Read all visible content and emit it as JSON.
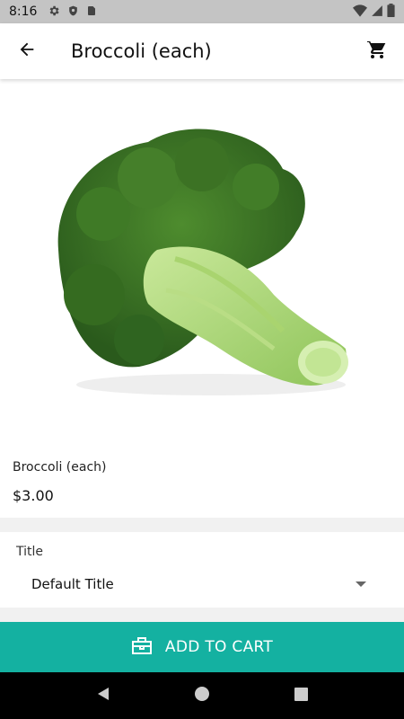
{
  "status_bar": {
    "time": "8:16",
    "icons": [
      "gear-icon",
      "shield-icon",
      "sim-card-icon",
      "wifi-icon",
      "signal-icon",
      "battery-icon"
    ]
  },
  "app_bar": {
    "title": "Broccoli (each)",
    "back_icon": "arrow-back-icon",
    "cart_icon": "shopping-cart-icon"
  },
  "product": {
    "image": "broccoli-image",
    "name": "Broccoli (each)",
    "price": "$3.00"
  },
  "variant": {
    "label": "Title",
    "selected": "Default Title"
  },
  "add_to_cart": {
    "label": "ADD TO CART",
    "icon": "briefcase-icon",
    "color": "#14b1a1"
  },
  "nav_bar": {
    "icons": [
      "back-triangle-icon",
      "home-circle-icon",
      "recents-square-icon"
    ]
  }
}
